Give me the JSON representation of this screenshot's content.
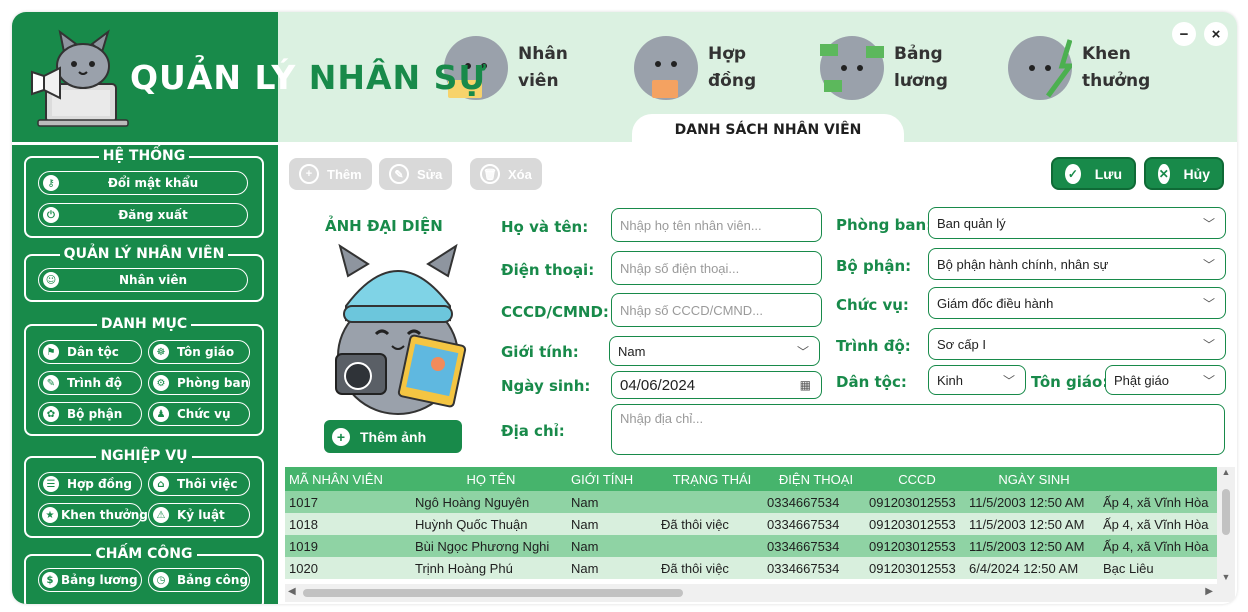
{
  "app": {
    "title_part1": "QUẢN LÝ ",
    "title_part2": "NHÂN SỰ"
  },
  "window": {
    "minimize": "−",
    "close": "×"
  },
  "nav": [
    {
      "line1": "Nhân",
      "line2": "viên"
    },
    {
      "line1": "Hợp",
      "line2": "đồng"
    },
    {
      "line1": "Bảng",
      "line2": "lương"
    },
    {
      "line1": "Khen",
      "line2": "thưởng"
    }
  ],
  "active_tab": "DANH SÁCH NHÂN VIÊN",
  "sidebar": {
    "he_thong": {
      "title": "HỆ THỐNG",
      "items": [
        "Đổi mật khẩu",
        "Đăng xuất"
      ]
    },
    "quan_ly": {
      "title": "QUẢN LÝ NHÂN VIÊN",
      "items": [
        "Nhân viên"
      ]
    },
    "danh_muc": {
      "title": "DANH MỤC",
      "items": [
        "Dân tộc",
        "Tôn giáo",
        "Trình độ",
        "Phòng ban",
        "Bộ phận",
        "Chức vụ"
      ]
    },
    "nghiep_vu": {
      "title": "NGHIỆP VỤ",
      "items": [
        "Hợp đồng",
        "Thôi việc",
        "Khen thưởng",
        "Kỷ luật"
      ]
    },
    "cham_cong": {
      "title": "CHẤM CÔNG",
      "items": [
        "Bảng lương",
        "Bảng công"
      ]
    }
  },
  "toolbar": {
    "add": "Thêm",
    "edit": "Sửa",
    "delete": "Xóa",
    "save": "Lưu",
    "cancel": "Hủy"
  },
  "avatar": {
    "title": "ẢNH ĐẠI DIỆN",
    "add_button": "Thêm ảnh"
  },
  "form": {
    "name_label": "Họ và tên:",
    "name_placeholder": "Nhập họ tên nhân viên...",
    "phone_label": "Điện thoại:",
    "phone_placeholder": "Nhập số điện thoại...",
    "id_label": "CCCD/CMND:",
    "id_placeholder": "Nhập số CCCD/CMND...",
    "gender_label": "Giới tính:",
    "gender_value": "Nam",
    "dob_label": "Ngày sinh:",
    "dob_value": "04/06/2024",
    "address_label": "Địa chỉ:",
    "address_placeholder": "Nhập địa chỉ...",
    "department_label": "Phòng ban:",
    "department_value": "Ban quản lý",
    "division_label": "Bộ phận:",
    "division_value": "Bộ phận hành chính, nhân sự",
    "position_label": "Chức vụ:",
    "position_value": "Giám đốc điều hành",
    "education_label": "Trình độ:",
    "education_value": "Sơ cấp I",
    "ethnicity_label": "Dân tộc:",
    "ethnicity_value": "Kinh",
    "religion_label": "Tôn giáo:",
    "religion_value": "Phật giáo"
  },
  "table": {
    "headers": [
      "MÃ NHÂN VIÊN",
      "HỌ TÊN",
      "GIỚI TÍNH",
      "TRẠNG THÁI",
      "ĐIỆN THOẠI",
      "CCCD",
      "NGÀY SINH",
      ""
    ],
    "rows": [
      [
        "1017",
        "Ngô Hoàng Nguyên",
        "Nam",
        "",
        "0334667534",
        "091203012553",
        "11/5/2003 12:50 AM",
        "Ấp 4, xã Vĩnh Hòa"
      ],
      [
        "1018",
        "Huỳnh Quốc Thuận",
        "Nam",
        "Đã thôi việc",
        "0334667534",
        "091203012553",
        "11/5/2003 12:50 AM",
        "Ấp 4, xã Vĩnh Hòa"
      ],
      [
        "1019",
        "Bùi Ngọc Phương Nghi",
        "Nam",
        "",
        "0334667534",
        "091203012553",
        "11/5/2003 12:50 AM",
        "Ấp 4, xã Vĩnh Hòa"
      ],
      [
        "1020",
        "Trịnh Hoàng Phú",
        "Nam",
        "Đã thôi việc",
        "0334667534",
        "091203012553",
        "6/4/2024 12:50 AM",
        "Bạc Liêu"
      ]
    ]
  },
  "colors": {
    "primary": "#188a4a",
    "header_bg": "#dbf1e1",
    "row_odd": "#8fd3a4",
    "row_even": "#d8efdd",
    "table_head": "#46b46c"
  }
}
